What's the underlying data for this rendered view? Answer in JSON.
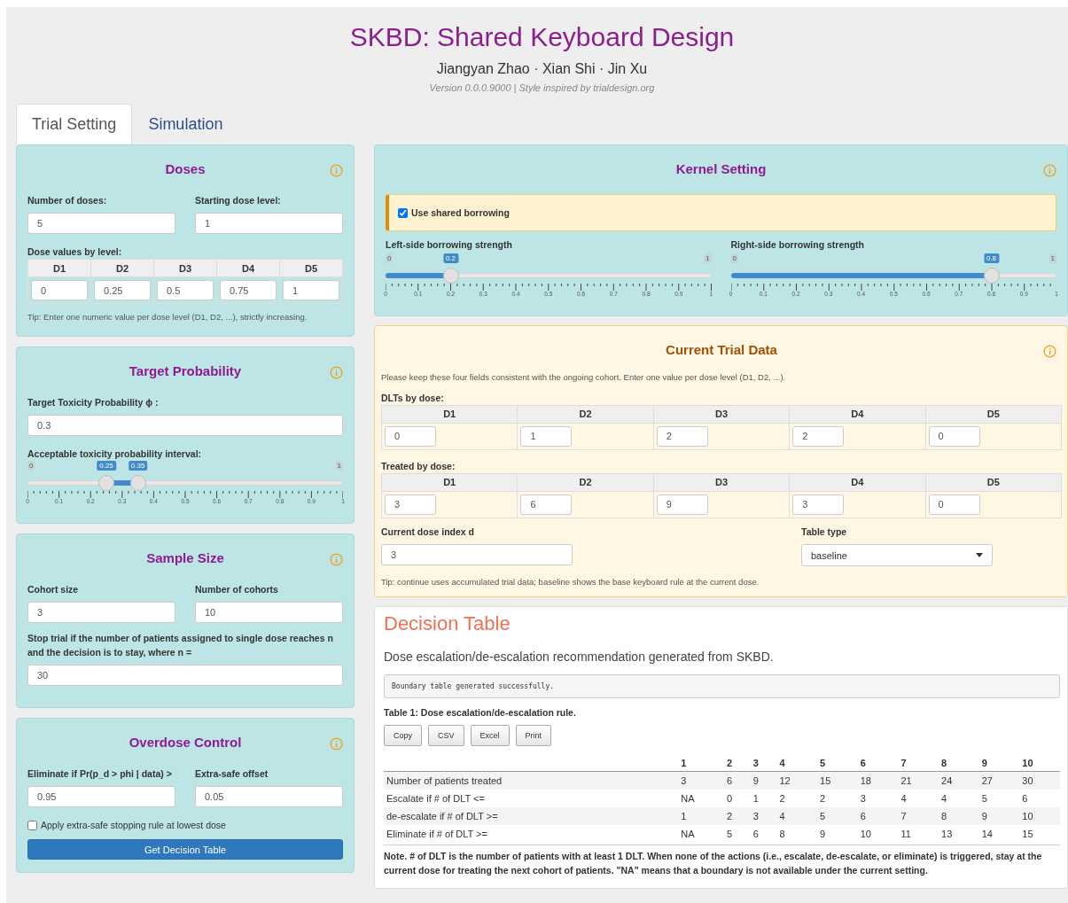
{
  "header": {
    "title": "SKBD: Shared Keyboard Design",
    "authors": "Jiangyan Zhao · Xian Shi · Jin Xu",
    "version": "Version 0.0.0.9000 | Style inspired by trialdesign.org"
  },
  "tabs": [
    {
      "label": "Trial Setting",
      "selected": true
    },
    {
      "label": "Simulation",
      "selected": false
    }
  ],
  "doses": {
    "title": "Doses",
    "num_doses": {
      "label": "Number of doses:",
      "value": "5"
    },
    "start_level": {
      "label": "Starting dose level:",
      "value": "1"
    },
    "dose_values": {
      "label": "Dose values by level:",
      "columns": [
        "D1",
        "D2",
        "D3",
        "D4",
        "D5"
      ],
      "values": [
        "0",
        "0.25",
        "0.5",
        "0.75",
        "1"
      ]
    },
    "tip": "Tip: Enter one numeric value per dose level (D1, D2, ...), strictly increasing."
  },
  "target": {
    "title": "Target Probability",
    "target_tox": {
      "label": "Target Toxicity Probability ϕ :",
      "value": "0.3"
    },
    "interval": {
      "label": "Acceptable toxicity probability interval:",
      "min": "0",
      "max": "1",
      "low": {
        "level": 0.25,
        "label": "0.25"
      },
      "high": {
        "level": 0.35,
        "label": "0.35"
      },
      "ticks": [
        "0",
        "0.1",
        "0.2",
        "0.3",
        "0.4",
        "0.5",
        "0.6",
        "0.7",
        "0.8",
        "0.9",
        "1"
      ]
    }
  },
  "sample_size": {
    "title": "Sample Size",
    "cohort_size": {
      "label": "Cohort size",
      "value": "3"
    },
    "num_cohorts": {
      "label": "Number of cohorts",
      "value": "10"
    },
    "stop_n": {
      "label": "Stop trial if the number of patients assigned to single dose reaches n and the decision is to stay, where n =",
      "value": "30"
    }
  },
  "overdose": {
    "title": "Overdose Control",
    "eliminate": {
      "label": "Eliminate if Pr(p_d > phi | data) >",
      "value": "0.95"
    },
    "offset": {
      "label": "Extra-safe offset",
      "value": "0.05"
    },
    "extra_safe": {
      "label": "Apply extra-safe stopping rule at lowest dose",
      "checked": false
    },
    "button": "Get Decision Table"
  },
  "kernel": {
    "title": "Kernel Setting",
    "borrowing": {
      "label": "Use shared borrowing",
      "checked": true
    },
    "left": {
      "label": "Left-side borrowing strength",
      "min": "0",
      "max": "1",
      "level": 0.2,
      "value": "0.2",
      "ticks": [
        "0",
        "0.1",
        "0.2",
        "0.3",
        "0.4",
        "0.5",
        "0.6",
        "0.7",
        "0.8",
        "0.9",
        "1"
      ]
    },
    "right": {
      "label": "Right-side borrowing strength",
      "min": "0",
      "max": "1",
      "level": 0.8,
      "value": "0.8",
      "ticks": [
        "0",
        "0.1",
        "0.2",
        "0.3",
        "0.4",
        "0.5",
        "0.6",
        "0.7",
        "0.8",
        "0.9",
        "1"
      ]
    }
  },
  "trial_data": {
    "title": "Current Trial Data",
    "note": "Please keep these four fields consistent with the ongoing cohort. Enter one value per dose level (D1, D2, ...).",
    "dlts": {
      "label": "DLTs by dose:",
      "columns": [
        "D1",
        "D2",
        "D3",
        "D4",
        "D5"
      ],
      "values": [
        "0",
        "1",
        "2",
        "2",
        "0"
      ]
    },
    "treated": {
      "label": "Treated by dose:",
      "columns": [
        "D1",
        "D2",
        "D3",
        "D4",
        "D5"
      ],
      "values": [
        "3",
        "6",
        "9",
        "3",
        "0"
      ]
    },
    "current_dose": {
      "label": "Current dose index d",
      "value": "3"
    },
    "table_type": {
      "label": "Table type",
      "value": "baseline"
    },
    "tip": "Tip: continue uses accumulated trial data; baseline shows the base keyboard rule at the current dose."
  },
  "decision": {
    "title": "Decision Table",
    "subtitle": "Dose escalation/de-escalation recommendation generated from SKBD.",
    "status": "Boundary table generated successfully.",
    "caption": "Table 1: Dose escalation/de-escalation rule.",
    "buttons": [
      "Copy",
      "CSV",
      "Excel",
      "Print"
    ],
    "columns": [
      "1",
      "2",
      "3",
      "4",
      "5",
      "6",
      "7",
      "8",
      "9",
      "10"
    ],
    "rows": [
      {
        "label": "Number of patients treated",
        "cells": [
          "3",
          "6",
          "9",
          "12",
          "15",
          "18",
          "21",
          "24",
          "27",
          "30"
        ]
      },
      {
        "label": "Escalate if # of DLT <=",
        "cells": [
          "NA",
          "0",
          "1",
          "2",
          "2",
          "3",
          "4",
          "4",
          "5",
          "6"
        ]
      },
      {
        "label": "de-escalate if # of DLT >=",
        "cells": [
          "1",
          "2",
          "3",
          "4",
          "5",
          "6",
          "7",
          "8",
          "9",
          "10"
        ]
      },
      {
        "label": "Eliminate if # of DLT >=",
        "cells": [
          "NA",
          "5",
          "6",
          "8",
          "9",
          "10",
          "11",
          "13",
          "14",
          "15"
        ]
      }
    ],
    "note": "Note. # of DLT is the number of patients with at least 1 DLT. When none of the actions (i.e., escalate, de-escalate, or eliminate) is triggered, stay at the current dose for treating the next cohort of patients. \"NA\" means that a boundary is not available under the current setting."
  }
}
